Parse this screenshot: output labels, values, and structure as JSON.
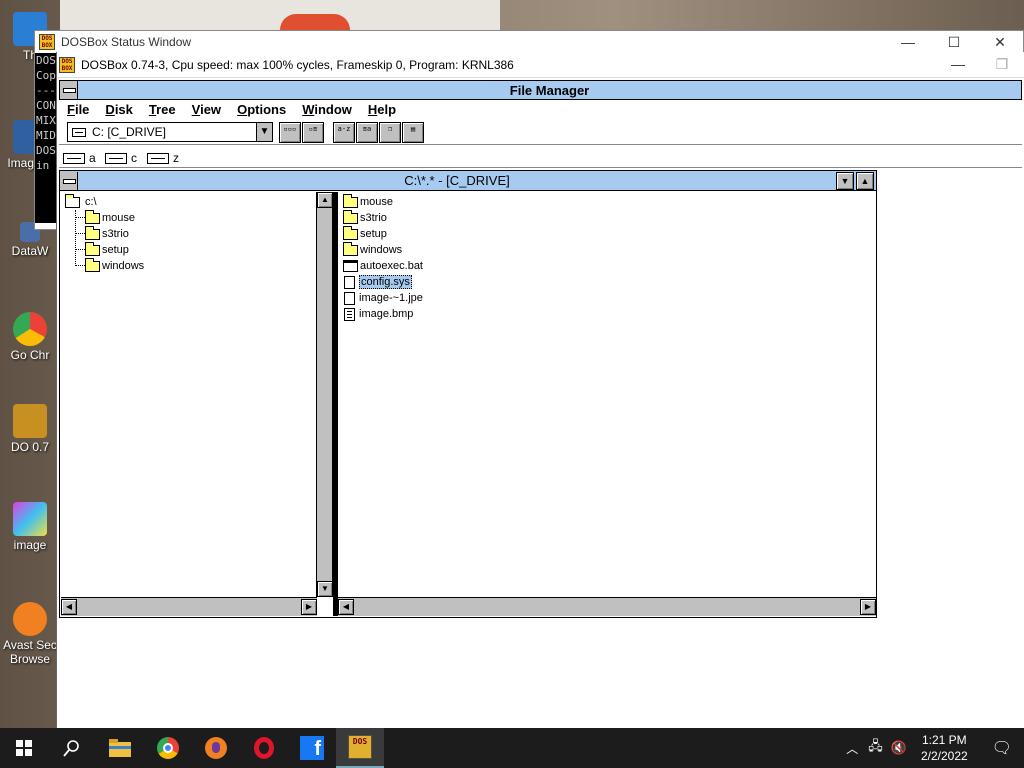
{
  "desktop": {
    "icons": [
      {
        "label": "Th",
        "color": "#2a7fd4"
      },
      {
        "label": "Imag Dri",
        "color": "#3060a0"
      },
      {
        "label": "DataW",
        "color": "#4a6fa8"
      },
      {
        "label": "Go Chr",
        "color": "#34a853"
      },
      {
        "label": "DO 0.7",
        "color": "#c89020"
      },
      {
        "label": "image",
        "color": "#c040c0"
      },
      {
        "label": "Avast Sec Browse",
        "color": "#f08020"
      }
    ]
  },
  "status_window": {
    "title": "DOSBox Status Window",
    "console_lines": [
      "DOS",
      "Cop",
      "---",
      "CON",
      "MIX",
      "MID",
      "DOS",
      "in"
    ]
  },
  "dosbox_window": {
    "title": "DOSBox 0.74-3, Cpu speed: max 100% cycles, Frameskip  0, Program:  KRNL386"
  },
  "window_controls": {
    "minimize": "—",
    "maximize": "☐",
    "close": "✕",
    "restore": "❐"
  },
  "file_manager": {
    "title": "File Manager",
    "menus": [
      "File",
      "Disk",
      "Tree",
      "View",
      "Options",
      "Window",
      "Help"
    ],
    "drive_select": "C: [C_DRIVE]",
    "toolbar_buttons": [
      {
        "name": "tree-view-button",
        "glyph": "▫▫▫"
      },
      {
        "name": "list-view-button",
        "glyph": "▫≡"
      },
      {
        "name": "sort-name-button",
        "glyph": "a-z"
      },
      {
        "name": "sort-type-button",
        "glyph": "≡a"
      },
      {
        "name": "new-window-button",
        "glyph": "❐"
      },
      {
        "name": "sort-size-button",
        "glyph": "▤"
      }
    ],
    "drives": [
      "a",
      "c",
      "z"
    ],
    "dir_window": {
      "title": "C:\\*.* - [C_DRIVE]",
      "tree": {
        "root": "c:\\",
        "children": [
          "mouse",
          "s3trio",
          "setup",
          "windows"
        ]
      },
      "files": [
        {
          "name": "mouse",
          "type": "folder"
        },
        {
          "name": "s3trio",
          "type": "folder"
        },
        {
          "name": "setup",
          "type": "folder"
        },
        {
          "name": "windows",
          "type": "folder"
        },
        {
          "name": "autoexec.bat",
          "type": "app"
        },
        {
          "name": "config.sys",
          "type": "file"
        },
        {
          "name": "image-~1.jpe",
          "type": "file"
        },
        {
          "name": "image.bmp",
          "type": "doc"
        }
      ],
      "selected_file": "config.sys"
    }
  },
  "taskbar": {
    "time": "1:21 PM",
    "date": "2/2/2022",
    "dosbox_label": "DOS"
  }
}
